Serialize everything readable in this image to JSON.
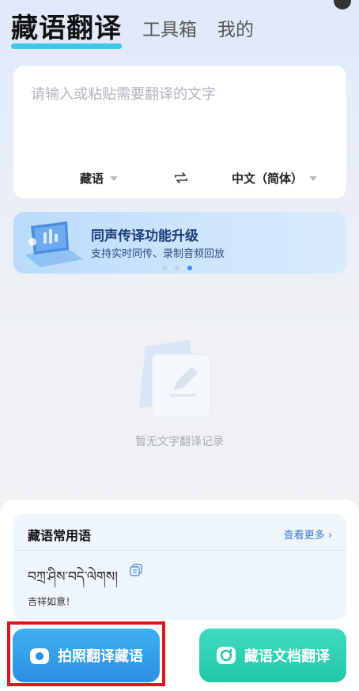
{
  "tabs": [
    {
      "label": "藏语翻译",
      "active": true
    },
    {
      "label": "工具箱",
      "active": false
    },
    {
      "label": "我的",
      "active": false
    }
  ],
  "input": {
    "placeholder": "请输入或粘贴需要翻译的文字",
    "source_lang": "藏语",
    "target_lang": "中文（简体）"
  },
  "banner": {
    "title": "同声传译功能升级",
    "subtitle": "支持实时同传、录制音频回放",
    "carousel_index": 3,
    "carousel_count": 3
  },
  "empty_state": {
    "text": "暂无文字翻译记录"
  },
  "phrases": {
    "title": "藏语常用语",
    "more_label": "查看更多 ›",
    "tibetan": "བཀྲ་ཤིས་བདེ་ལེགས།",
    "translation": "吉祥如意！"
  },
  "actions": {
    "photo_label": "拍照翻译藏语",
    "doc_label": "藏语文档翻译"
  },
  "colors": {
    "accent_blue": "#2a8fe2",
    "accent_green": "#22c7a7",
    "tab_underline": "#41c5e8",
    "highlight_red": "#e0141d"
  }
}
